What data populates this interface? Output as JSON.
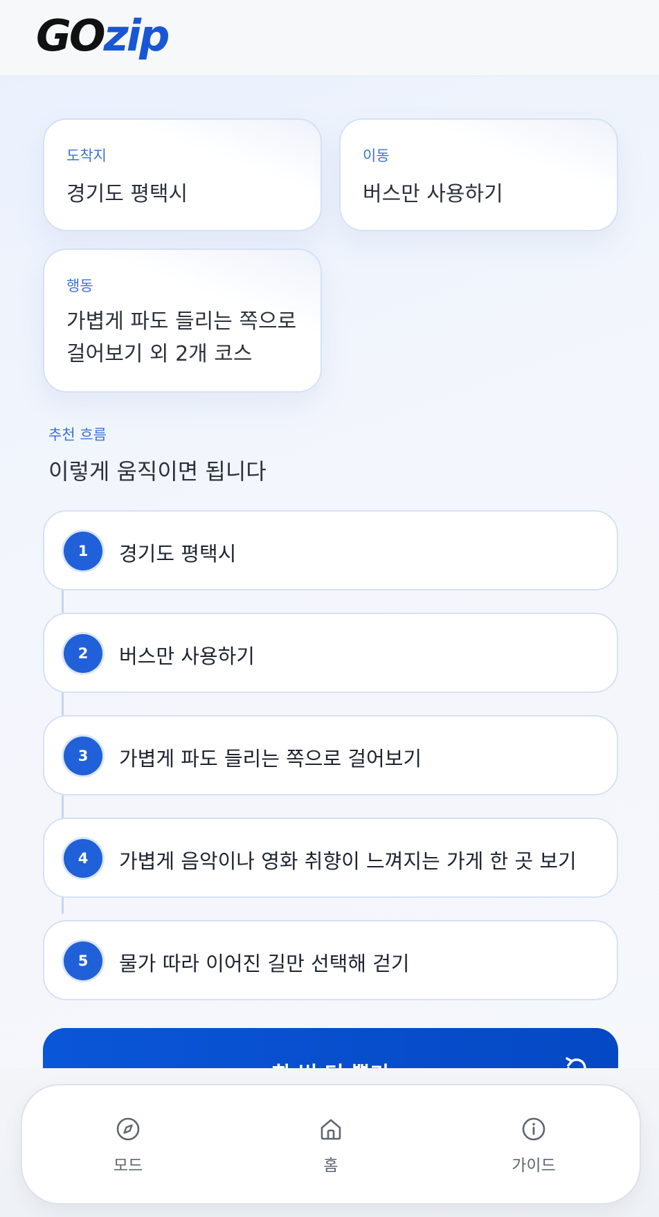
{
  "header": {
    "logo_go": "GO",
    "logo_zip": "zip"
  },
  "cards": {
    "destination": {
      "label": "도착지",
      "value": "경기도 평택시"
    },
    "movement": {
      "label": "이동",
      "value": "버스만 사용하기"
    },
    "action": {
      "label": "행동",
      "value": "가볍게 파도 들리는 쪽으로 걸어보기 외 2개 코스"
    }
  },
  "flow": {
    "label": "추천 흐름",
    "title": "이렇게 움직이면 됩니다",
    "steps": [
      {
        "num": "1",
        "text": "경기도 평택시"
      },
      {
        "num": "2",
        "text": "버스만 사용하기"
      },
      {
        "num": "3",
        "text": "가볍게 파도 들리는 쪽으로 걸어보기"
      },
      {
        "num": "4",
        "text": "가볍게 음악이나 영화 취향이 느껴지는 가게 한 곳 보기"
      },
      {
        "num": "5",
        "text": "물가 따라 이어진 길만 선택해 걷기"
      }
    ]
  },
  "cta": {
    "label": "한 번 더 뽑기",
    "icon": "refresh-icon"
  },
  "nav": {
    "items": [
      {
        "label": "모드",
        "icon": "compass-icon"
      },
      {
        "label": "홈",
        "icon": "home-icon"
      },
      {
        "label": "가이드",
        "icon": "info-icon"
      }
    ]
  },
  "colors": {
    "accent": "#1956d6",
    "cta": "#0a56d8",
    "label": "#3a72d6"
  }
}
